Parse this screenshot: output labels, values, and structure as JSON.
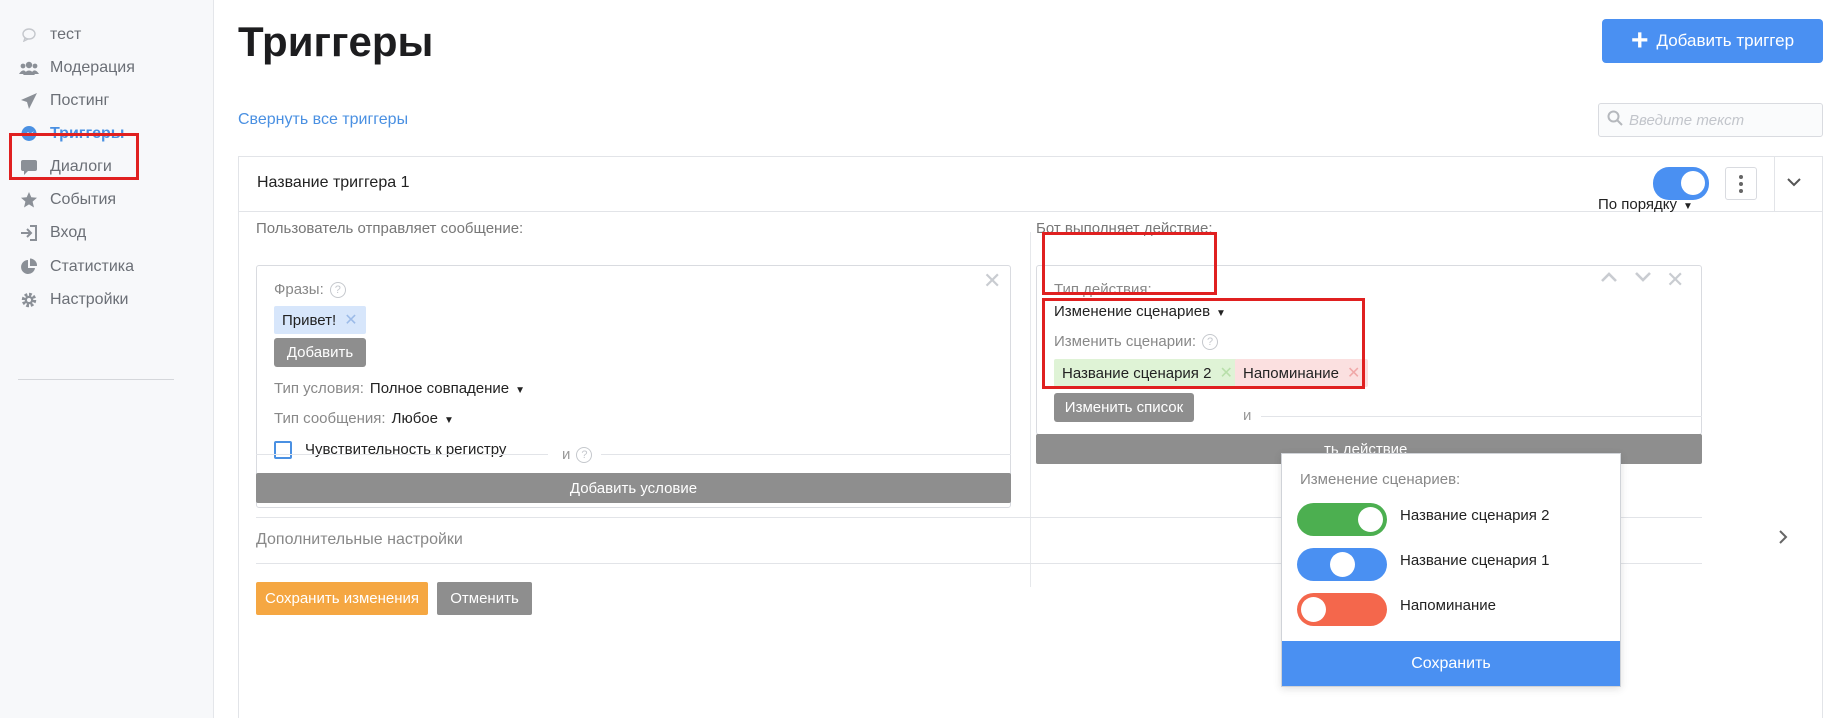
{
  "sidebar": {
    "items": [
      {
        "label": "тест",
        "icon": "chat-bubble-icon"
      },
      {
        "label": "Модерация",
        "icon": "users-icon"
      },
      {
        "label": "Постинг",
        "icon": "paper-plane-icon"
      },
      {
        "label": "Триггеры",
        "icon": "messenger-icon"
      },
      {
        "label": "Диалоги",
        "icon": "speech-icon"
      },
      {
        "label": "События",
        "icon": "star-icon"
      },
      {
        "label": "Вход",
        "icon": "login-icon"
      },
      {
        "label": "Статистика",
        "icon": "pie-chart-icon"
      },
      {
        "label": "Настройки",
        "icon": "gear-icon"
      }
    ],
    "active": "Триггеры"
  },
  "header": {
    "title": "Триггеры",
    "add_button": "Добавить триггер",
    "collapse_all": "Свернуть все триггеры",
    "search_placeholder": "Введите текст"
  },
  "trigger": {
    "name": "Название триггера 1",
    "enabled": true,
    "left": {
      "heading": "Пользователь отправляет сообщение:",
      "phrases_label": "Фразы:",
      "phrases": [
        "Привет!"
      ],
      "add_button": "Добавить",
      "condition_type_label": "Тип условия:",
      "condition_type_value": "Полное совпадение",
      "message_type_label": "Тип сообщения:",
      "message_type_value": "Любое",
      "case_sensitive_label": "Чувствительность к регистру",
      "case_sensitive": false,
      "and_text": "и",
      "add_condition": "Добавить условие"
    },
    "right": {
      "heading": "Бот выполняет действие:",
      "order_value": "По порядку",
      "action_type_label": "Тип действия:",
      "action_type_value": "Изменение сценариев",
      "change_scenarios_label": "Изменить сценарии:",
      "scenarios": [
        {
          "label": "Название сценария 2",
          "color": "green"
        },
        {
          "label": "Напоминание",
          "color": "red"
        }
      ],
      "change_list_button": "Изменить список",
      "and_text": "и",
      "add_action_partial": "ть действие"
    },
    "extra_settings": "Дополнительные настройки",
    "save_button": "Сохранить изменения",
    "cancel_button": "Отменить"
  },
  "popover": {
    "title": "Изменение сценариев:",
    "items": [
      {
        "label": "Название сценария 2",
        "color": "#4caf50",
        "state": "on"
      },
      {
        "label": "Название сценария 1",
        "color": "#4a90f2",
        "state": "neutral"
      },
      {
        "label": "Напоминание",
        "color": "#f4674c",
        "state": "off"
      }
    ],
    "save_button": "Сохранить"
  },
  "colors": {
    "accent": "#4a90f2",
    "highlight": "#e02020",
    "save": "#f5a742",
    "grey_button": "#8e8e8e"
  }
}
